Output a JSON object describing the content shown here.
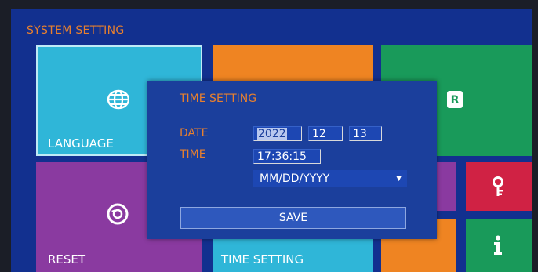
{
  "system_title": "SYSTEM SETTING",
  "tiles": {
    "language": "LANGUAGE",
    "reset": "RESET",
    "time_setting": "TIME SETTING"
  },
  "dialog": {
    "title": "TIME SETTING",
    "date_label": "DATE",
    "time_label": "TIME",
    "year": "2022",
    "month": "12",
    "day": "13",
    "time_value": "17:36:15",
    "date_format": "MM/DD/YYYY",
    "save_label": "SAVE"
  },
  "colors": {
    "background": "#12308f",
    "accent": "#e8802e",
    "tile_cyan": "#2fb6d8",
    "tile_orange": "#ef8422",
    "tile_green": "#199a5a",
    "tile_purple": "#8a3aa0",
    "tile_red": "#d02244"
  },
  "icons": {
    "language": "globe-icon",
    "reset": "reset-icon",
    "remote": "remote-r-icon",
    "key": "key-icon",
    "info": "info-icon",
    "dropdown": "chevron-down-icon"
  }
}
